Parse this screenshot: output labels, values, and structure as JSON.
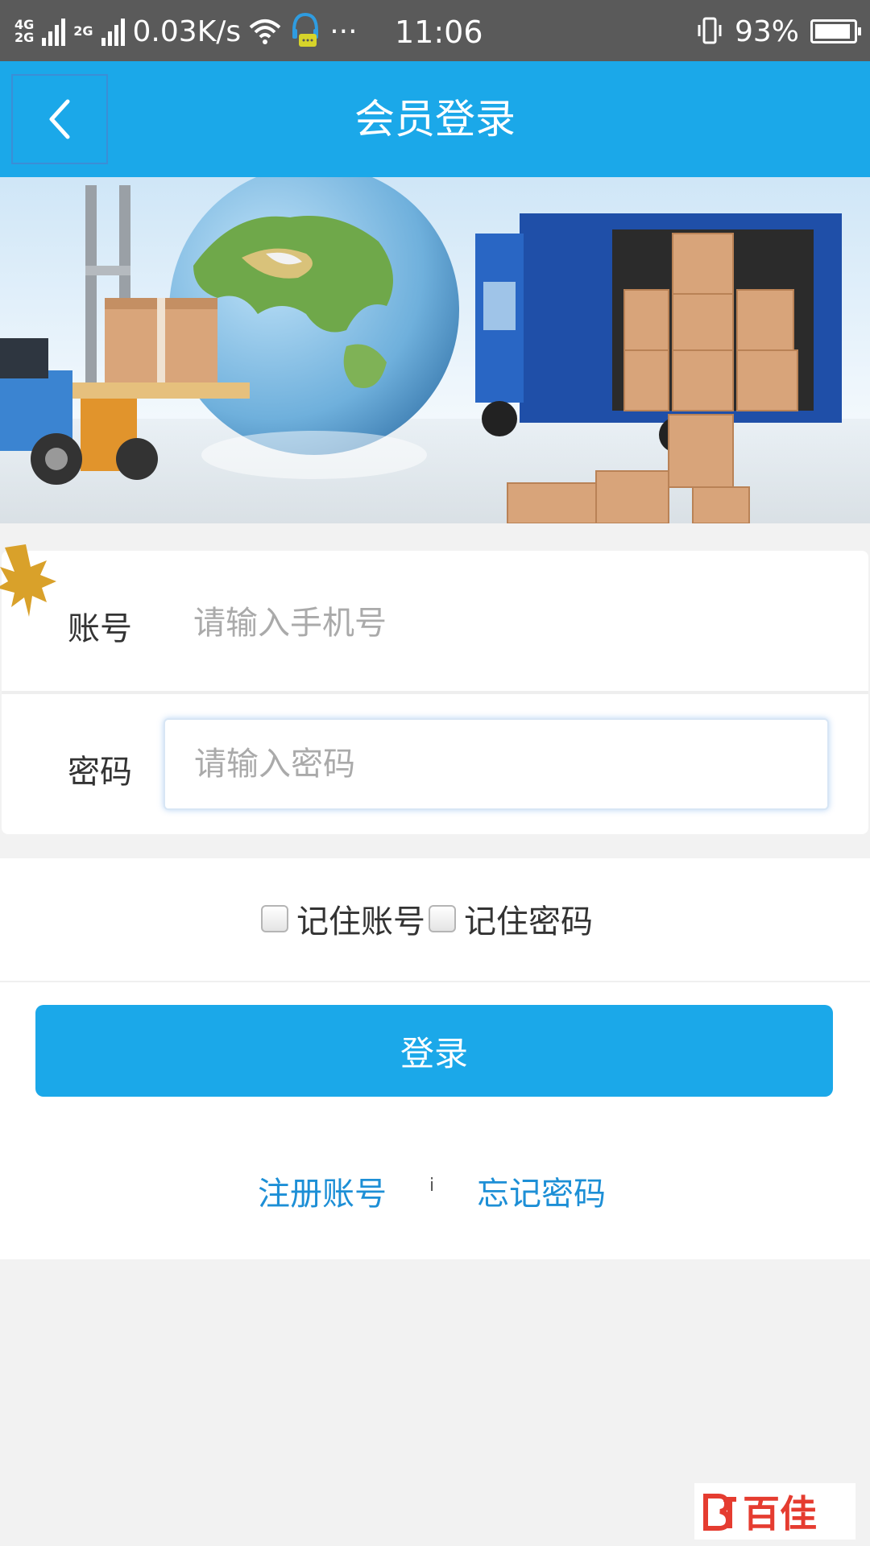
{
  "status_bar": {
    "network_top": "4G",
    "network_bottom": "2G",
    "network_second": "2G",
    "speed": "0.03K/s",
    "more": "···",
    "time": "11:06",
    "battery_level": 0.93,
    "battery_text": "93%"
  },
  "header": {
    "title": "会员登录",
    "back_icon": "chevron-left-icon"
  },
  "form": {
    "account_label": "账号",
    "account_placeholder": "请输入手机号",
    "account_value": "",
    "password_label": "密码",
    "password_placeholder": "请输入密码",
    "password_value": ""
  },
  "remember": {
    "remember_account": "记住账号",
    "remember_account_checked": false,
    "remember_password": "记住密码",
    "remember_password_checked": false
  },
  "actions": {
    "login": "登录",
    "register": "注册账号",
    "separator": "i",
    "forgot": "忘记密码"
  },
  "watermark": {
    "text": "百佳"
  },
  "colors": {
    "primary": "#1ba8e9",
    "link": "#1d8fd6",
    "status_bar": "#5a5a5a",
    "background": "#f2f2f2",
    "watermark": "#e53c30"
  }
}
